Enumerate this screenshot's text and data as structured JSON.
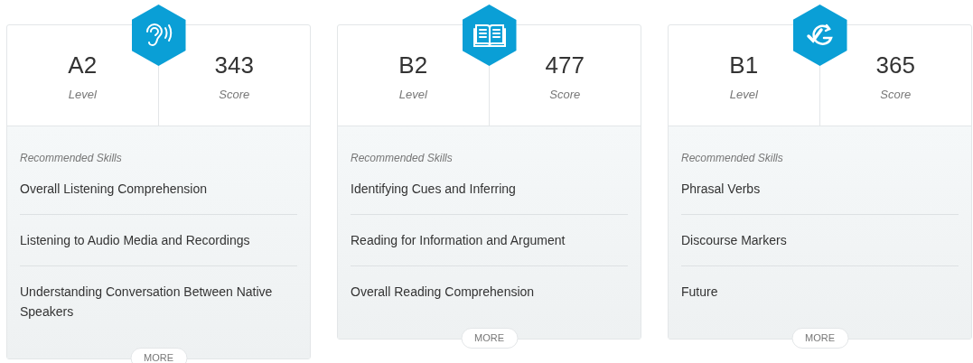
{
  "cards": [
    {
      "kind": "listening",
      "level": "A2",
      "level_label": "Level",
      "score": "343",
      "score_label": "Score",
      "skills_title": "Recommended Skills",
      "skills": [
        "Overall Listening Comprehension",
        "Listening to Audio Media and Recordings",
        "Understanding Conversation Between Native Speakers"
      ],
      "more": "MORE"
    },
    {
      "kind": "reading",
      "level": "B2",
      "level_label": "Level",
      "score": "477",
      "score_label": "Score",
      "skills_title": "Recommended Skills",
      "skills": [
        "Identifying Cues and Inferring",
        "Reading for Information and Argument",
        "Overall Reading Comprehension"
      ],
      "more": "MORE"
    },
    {
      "kind": "grammar",
      "level": "B1",
      "level_label": "Level",
      "score": "365",
      "score_label": "Score",
      "skills_title": "Recommended Skills",
      "skills": [
        "Phrasal Verbs",
        "Discourse Markers",
        "Future"
      ],
      "more": "MORE"
    }
  ]
}
